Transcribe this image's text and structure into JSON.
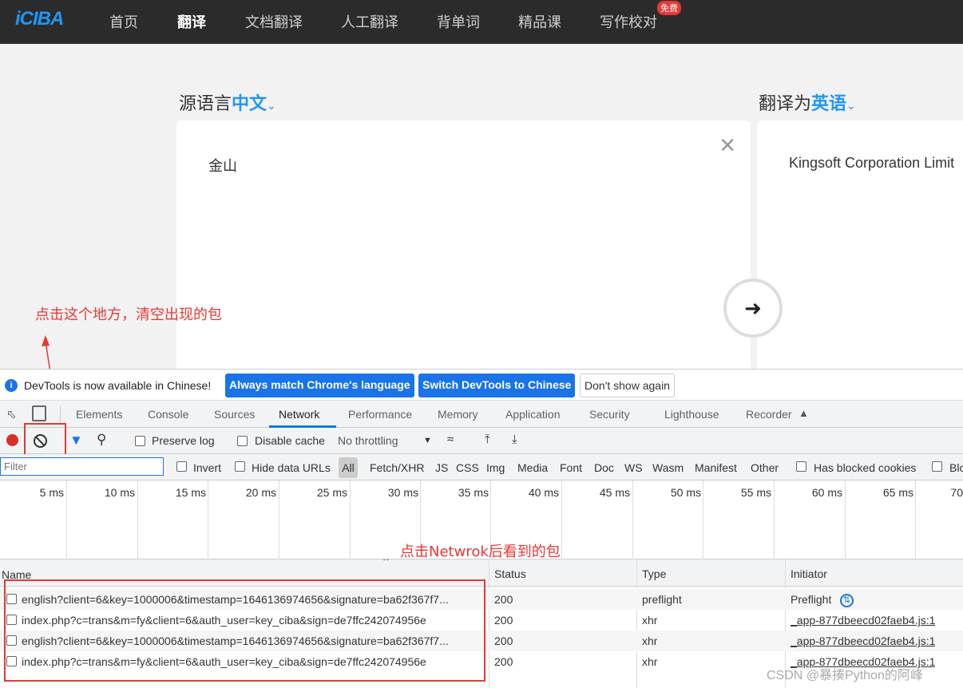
{
  "nav": {
    "logo": "iCIBA",
    "items": [
      "首页",
      "翻译",
      "文档翻译",
      "人工翻译",
      "背单词",
      "精品课",
      "写作校对"
    ],
    "badge": "免费"
  },
  "translate": {
    "source_prefix": "源语言",
    "source_lang": "中文",
    "target_prefix": "翻译为",
    "target_lang": "英语",
    "source_text": "金山",
    "result_text": "Kingsoft Corporation Limit"
  },
  "annotations": {
    "clear_hint": "点击这个地方，清空出现的包",
    "network_hint": "点击Netwrok后看到的包"
  },
  "devtools": {
    "infobar": {
      "text": "DevTools is now available in Chinese!",
      "btn_match": "Always match Chrome's language",
      "btn_switch": "Switch DevTools to Chinese",
      "btn_dismiss": "Don't show again"
    },
    "tabs": [
      "Elements",
      "Console",
      "Sources",
      "Network",
      "Performance",
      "Memory",
      "Application",
      "Security",
      "Lighthouse",
      "Recorder"
    ],
    "toolbar": {
      "preserve_log": "Preserve log",
      "disable_cache": "Disable cache",
      "throttling": "No throttling"
    },
    "filter": {
      "placeholder": "Filter",
      "invert": "Invert",
      "hide_data_urls": "Hide data URLs",
      "types": [
        "All",
        "Fetch/XHR",
        "JS",
        "CSS",
        "Img",
        "Media",
        "Font",
        "Doc",
        "WS",
        "Wasm",
        "Manifest",
        "Other"
      ],
      "has_blocked_cookies": "Has blocked cookies",
      "blocked_requests": "Blo"
    },
    "timeline_ticks": [
      "5 ms",
      "10 ms",
      "15 ms",
      "20 ms",
      "25 ms",
      "30 ms",
      "35 ms",
      "40 ms",
      "45 ms",
      "50 ms",
      "55 ms",
      "60 ms",
      "65 ms",
      "70"
    ],
    "table": {
      "headers": {
        "name": "Name",
        "status": "Status",
        "type": "Type",
        "initiator": "Initiator"
      },
      "rows": [
        {
          "name": "english?client=6&key=1000006&timestamp=1646136974656&signature=ba62f367f7...",
          "status": "200",
          "type": "preflight",
          "initiator": "Preflight"
        },
        {
          "name": "index.php?c=trans&m=fy&client=6&auth_user=key_ciba&sign=de7ffc242074956e",
          "status": "200",
          "type": "xhr",
          "initiator": "_app-877dbeecd02faeb4.js:1"
        },
        {
          "name": "english?client=6&key=1000006&timestamp=1646136974656&signature=ba62f367f7...",
          "status": "200",
          "type": "xhr",
          "initiator": "_app-877dbeecd02faeb4.js:1"
        },
        {
          "name": "index.php?c=trans&m=fy&client=6&auth_user=key_ciba&sign=de7ffc242074956e",
          "status": "200",
          "type": "xhr",
          "initiator": "_app-877dbeecd02faeb4.js:1"
        }
      ]
    }
  },
  "watermark": "CSDN @暴揍Python的阿峰"
}
